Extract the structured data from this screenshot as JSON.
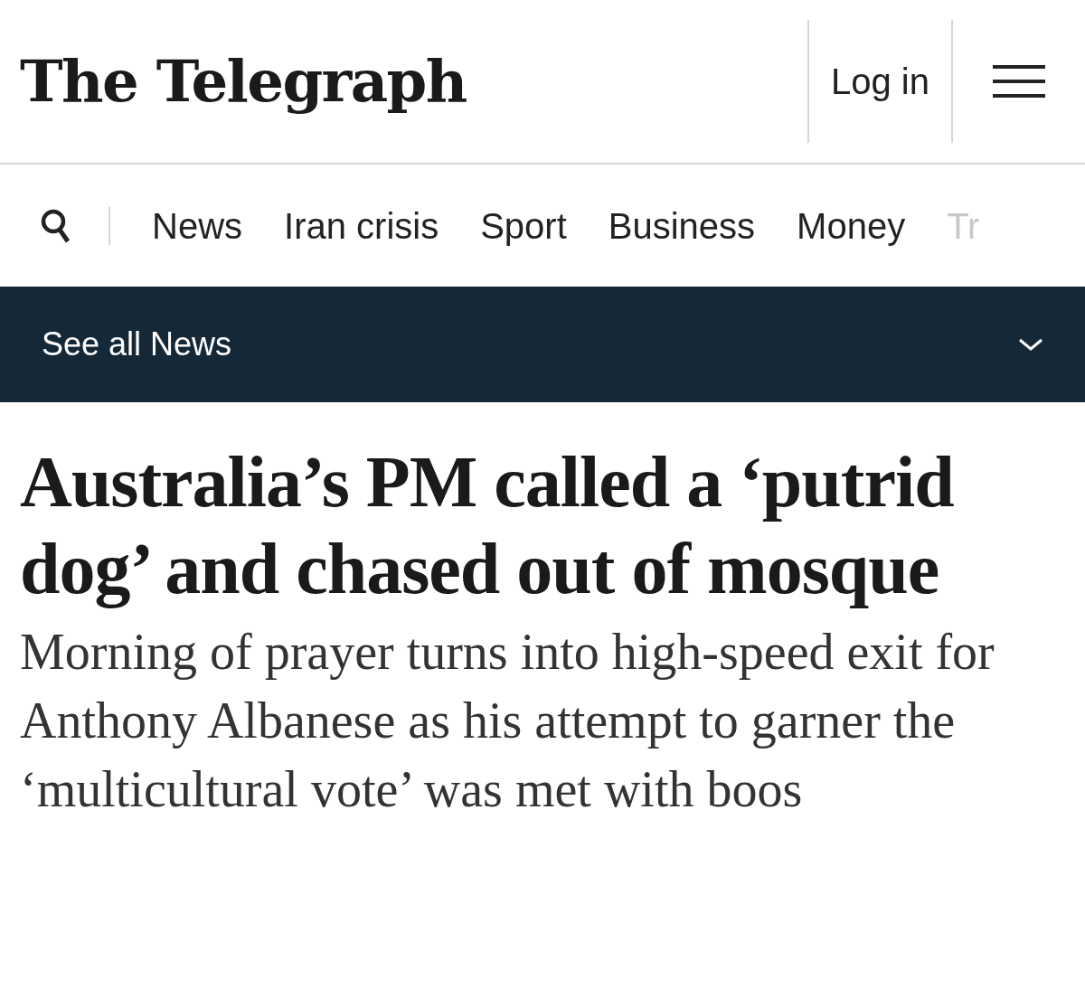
{
  "header": {
    "logo": "The Telegraph",
    "login": "Log in"
  },
  "nav": {
    "items": [
      {
        "label": "News",
        "faded": false
      },
      {
        "label": "Iran crisis",
        "faded": false
      },
      {
        "label": "Sport",
        "faded": false
      },
      {
        "label": "Business",
        "faded": false
      },
      {
        "label": "Money",
        "faded": false
      },
      {
        "label": "Tr",
        "faded": true
      }
    ]
  },
  "section_bar": {
    "label": "See all News"
  },
  "article": {
    "headline": "Australia’s PM called a ‘putrid dog’ and chased out of mosque",
    "standfirst": "Morning of prayer turns into high-speed exit for Anthony Albanese as his attempt to garner the ‘multicultural vote’ was met with boos"
  }
}
